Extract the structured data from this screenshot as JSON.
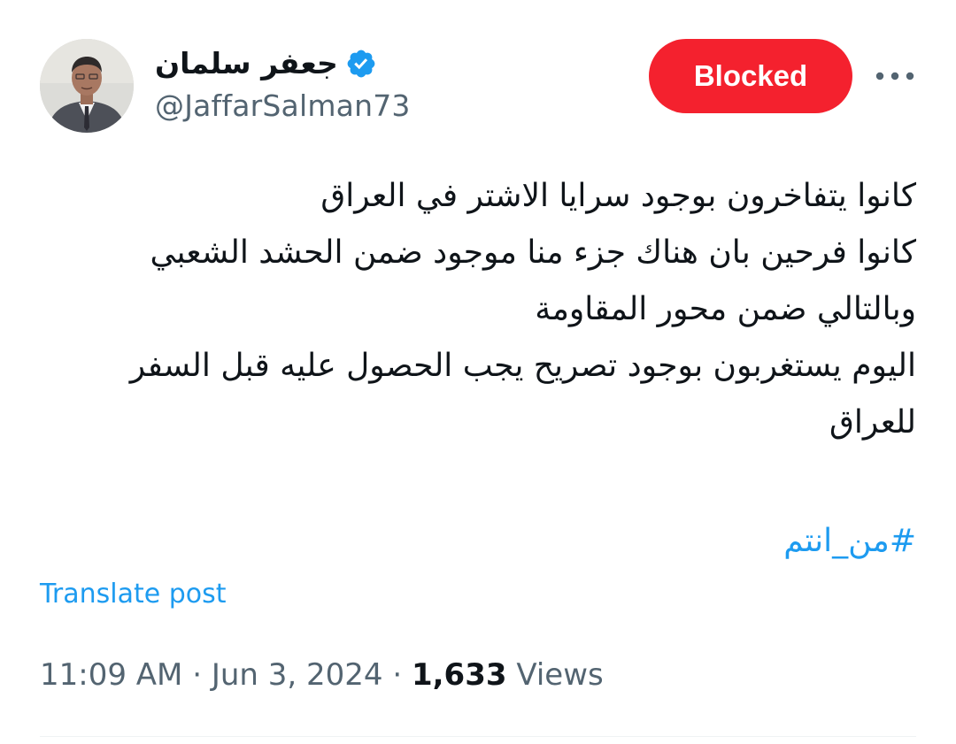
{
  "author": {
    "display_name": "جعفر سلمان",
    "handle": "@JaffarSalman73",
    "verified": true,
    "avatar_icon": "profile-photo"
  },
  "actions": {
    "blocked_label": "Blocked",
    "more_icon": "more-horizontal-icon"
  },
  "post": {
    "lines": [
      "كانوا يتفاخرون بوجود سرايا الاشتر في العراق",
      "كانوا فرحين بان هناك جزء منا موجود ضمن الحشد الشعبي",
      "وبالتالي ضمن محور المقاومة",
      "اليوم يستغربون بوجود تصريح يجب الحصول عليه قبل السفر",
      "للعراق"
    ],
    "hashtag": "#من_انتم",
    "translate_label": "Translate post"
  },
  "meta": {
    "time": "11:09 AM",
    "separator": "·",
    "date": "Jun 3, 2024",
    "views_count": "1,633",
    "views_label": "Views"
  },
  "colors": {
    "blocked_bg": "#f4212e",
    "link": "#1d9bf0",
    "secondary_text": "#536471",
    "primary_text": "#0f1419"
  }
}
